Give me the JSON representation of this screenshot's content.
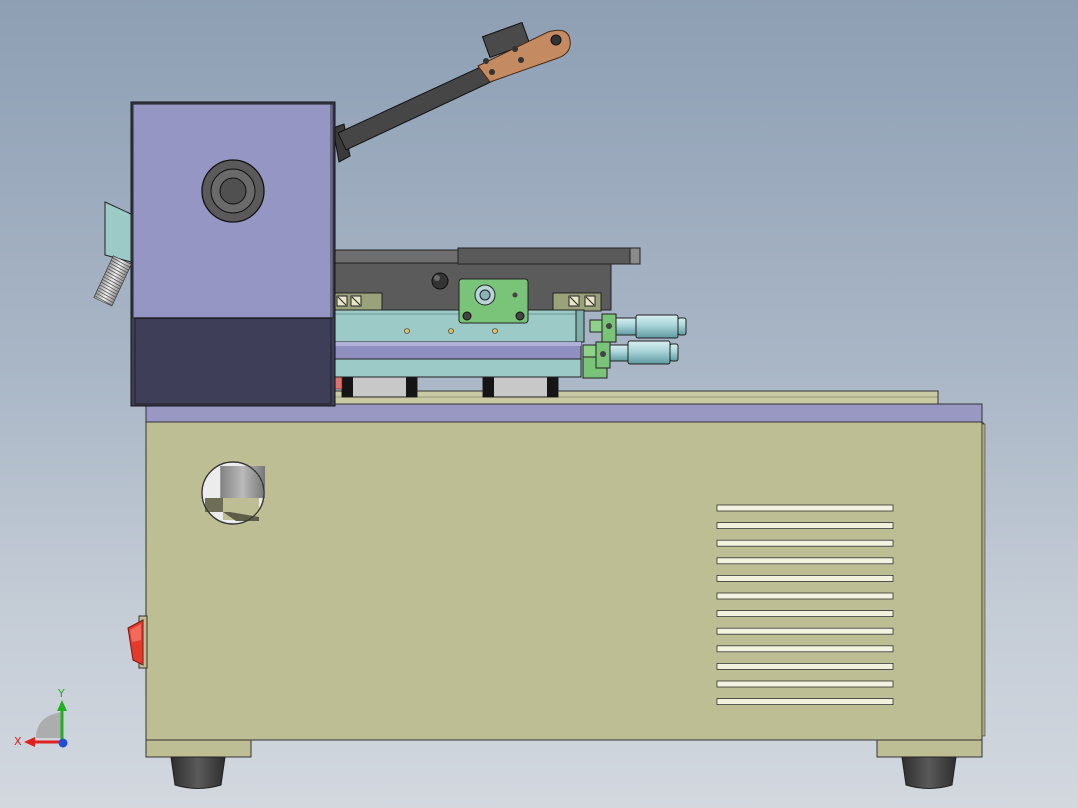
{
  "viewport": {
    "background_top": "#8e9fb4",
    "background_bottom": "#d3d8df"
  },
  "model": {
    "view": "side",
    "colors": {
      "base_cabinet": "#bebe94",
      "base_top_strip": "#9898c2",
      "head_housing": "#9696c4",
      "head_lower": "#3e3e58",
      "arm": "#464646",
      "arm_bracket": "#c48b62",
      "slide_plate": "#9ccac6",
      "mount_block": "#79c479",
      "rail_blocks": "#c8c8c8",
      "vent_slots": "#f3f2de",
      "power_switch": "#e43a2c",
      "feet": "#444444"
    },
    "vent_slot_count": 12
  },
  "triad": {
    "x_label": "X",
    "y_label": "Y",
    "x_color": "#e02020",
    "y_color": "#20b020",
    "z_color": "#2050d0"
  }
}
